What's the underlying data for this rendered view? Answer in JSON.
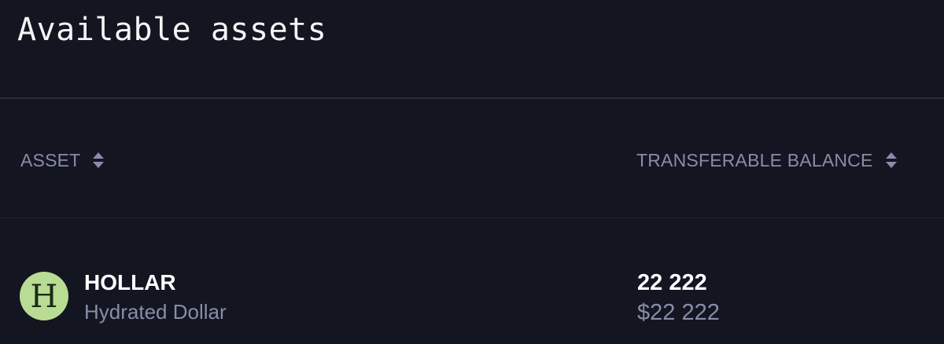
{
  "header": {
    "title": "Available assets"
  },
  "table": {
    "columns": [
      {
        "label": "ASSET",
        "sort_icon": "sort-updown-icon"
      },
      {
        "label": "TRANSFERABLE BALANCE",
        "sort_icon": "sort-updown-icon"
      }
    ],
    "rows": [
      {
        "logo_letter": "H",
        "symbol": "HOLLAR",
        "name": "Hydrated Dollar",
        "balance": "22 222",
        "balance_usd": "$22 222"
      }
    ]
  },
  "colors": {
    "background": "#131521",
    "muted_text": "#8a8ca8",
    "logo_bg": "#b8dc94"
  }
}
